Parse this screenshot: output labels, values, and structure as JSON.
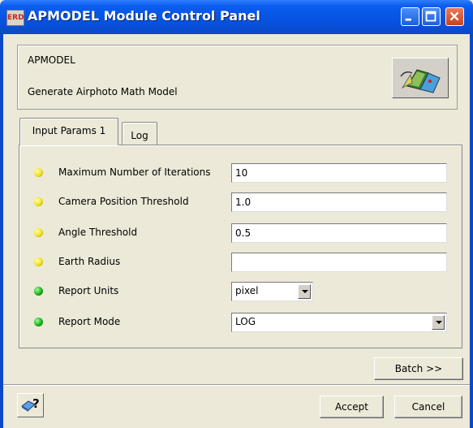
{
  "window": {
    "title": "APMODEL Module Control Panel",
    "icon_text": "ERD"
  },
  "module": {
    "name": "APMODEL",
    "description": "Generate Airphoto Math Model"
  },
  "tabs": [
    {
      "label": "Input Params 1",
      "active": true
    },
    {
      "label": "Log",
      "active": false
    }
  ],
  "params": {
    "max_iterations": {
      "label": "Maximum Number of Iterations",
      "value": "10",
      "status": "yellow"
    },
    "camera_threshold": {
      "label": "Camera Position Threshold",
      "value": "1.0",
      "status": "yellow"
    },
    "angle_threshold": {
      "label": "Angle Threshold",
      "value": "0.5",
      "status": "yellow"
    },
    "earth_radius": {
      "label": "Earth Radius",
      "value": "",
      "status": "yellow"
    },
    "report_units": {
      "label": "Report Units",
      "value": "pixel",
      "status": "green"
    },
    "report_mode": {
      "label": "Report Mode",
      "value": "LOG",
      "status": "green"
    }
  },
  "buttons": {
    "batch": "Batch >>",
    "accept": "Accept",
    "cancel": "Cancel",
    "help_glyph": "?"
  },
  "colors": {
    "status_yellow": "#f0e020",
    "status_green": "#18b018",
    "titlebar": "#0653e0"
  }
}
